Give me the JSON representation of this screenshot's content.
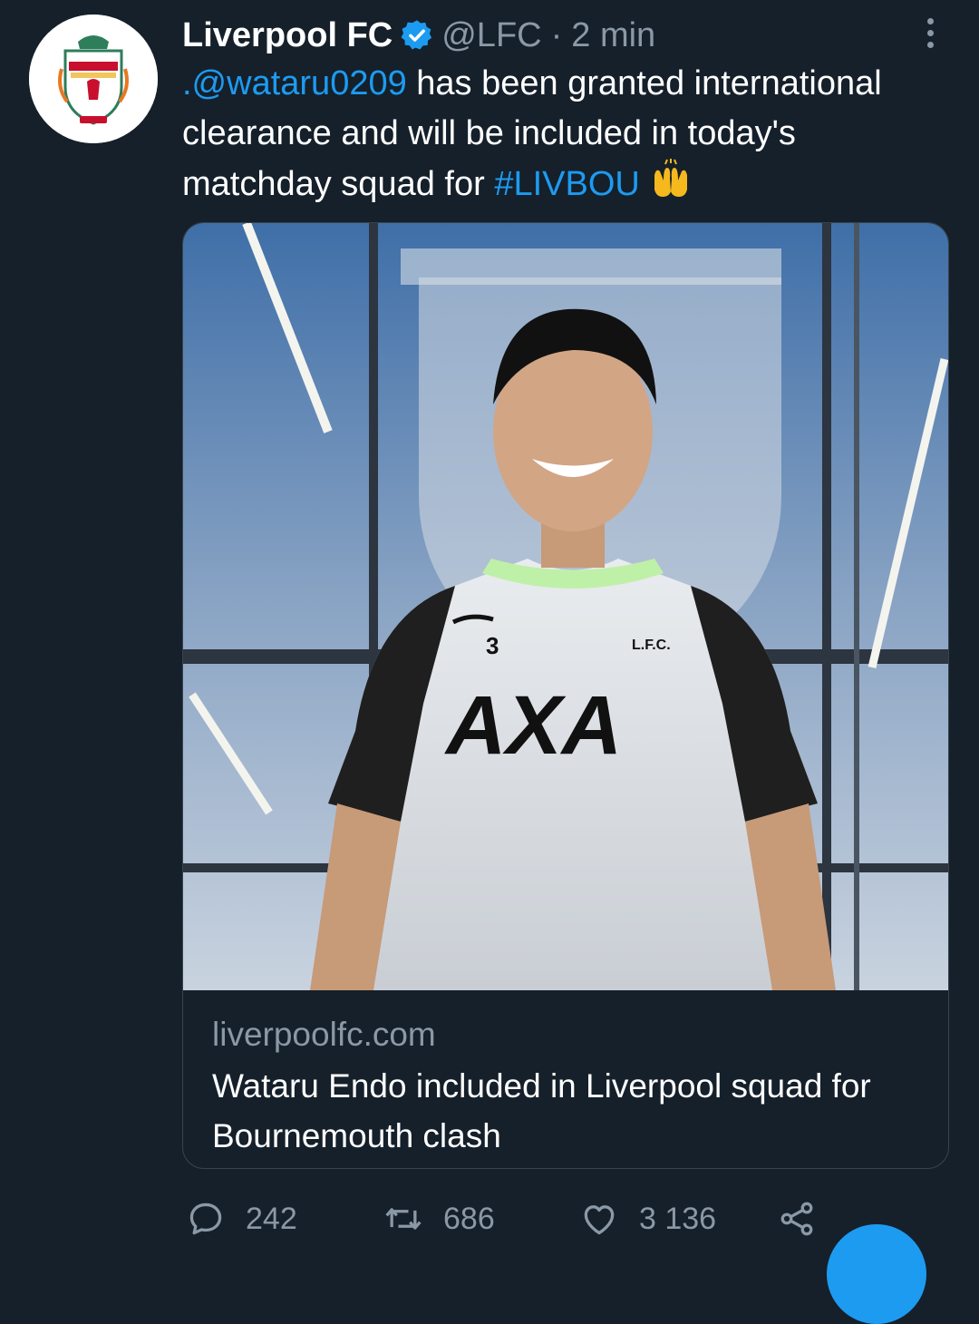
{
  "tweet": {
    "author_name": "Liverpool FC",
    "handle": "@LFC",
    "separator": "·",
    "time": "2 min",
    "text_mention": ".@wataru0209",
    "text_part1": " has been granted international clearance and will be included in today's matchday squad for ",
    "text_hashtag": "#LIVBOU",
    "emoji": "raising-hands"
  },
  "card": {
    "domain": "liverpoolfc.com",
    "title": "Wataru Endo included in Liverpool squad for Bournemouth clash",
    "image_shirt_number": "3",
    "image_sponsor": "AXA",
    "image_crest_text": "L.F.C."
  },
  "actions": {
    "replies": "242",
    "retweets": "686",
    "likes": "3 136"
  },
  "colors": {
    "background": "#15202b",
    "accent": "#1d9bf0",
    "muted": "#8b98a5",
    "border": "#38444d"
  },
  "icons": [
    "verified-badge-icon",
    "more-options-icon",
    "reply-icon",
    "retweet-icon",
    "like-icon",
    "share-icon"
  ]
}
